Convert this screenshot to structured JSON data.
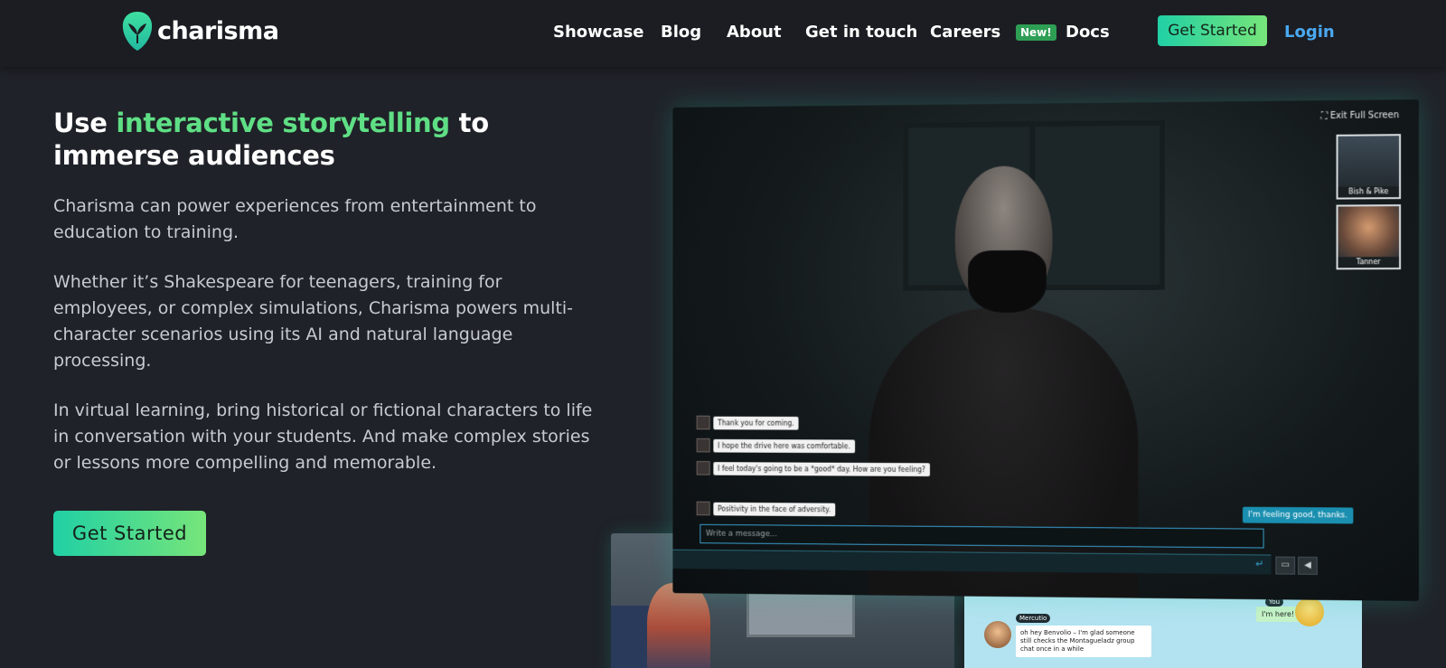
{
  "nav": {
    "brand": "charisma",
    "links": [
      "Showcase",
      "Blog",
      "About",
      "Get in touch",
      "Careers",
      "Docs"
    ],
    "careers_badge": "New!",
    "cta": "Get Started",
    "login": "Login"
  },
  "hero": {
    "headline_pre": "Use ",
    "headline_highlight": "interactive storytelling",
    "headline_post": " to immerse audiences",
    "paragraphs": [
      "Charisma can power experiences from entertainment to education to training.",
      "Whether it’s Shakespeare for teenagers, training for employees, or complex simulations, Charisma powers multi-character scenarios using its AI and natural language processing.",
      "In virtual learning, bring historical or fictional characters to life in conversation with your students. And make complex stories or lessons more compelling and memorable."
    ],
    "cta": "Get Started"
  },
  "demo": {
    "exit_fullscreen": "Exit Full Screen",
    "thumbnails": [
      "Bish & Pike",
      "Tanner"
    ],
    "messages": [
      "Thank you for coming.",
      "I hope the drive here was comfortable.",
      "I feel today's going to be a *good* day. How are you feeling?",
      "Positivity in the face of adversity."
    ],
    "reply": "I'm feeling good, thanks.",
    "input_placeholder": "Write a message...",
    "send_icon": "↵",
    "chat_icon": "speech-bubble-icon",
    "sound_icon": "speaker-icon"
  },
  "demo_chat": {
    "you_label": "You",
    "you_message": "I'm here!",
    "mercutio_label": "Mercutio",
    "mercutio_message": "oh hey Benvolio – I'm glad someone still checks the Montagueladz group chat once in a while"
  },
  "colors": {
    "accent_green": "#5fdf85",
    "cta_gradient_start": "#20d0a5",
    "cta_gradient_end": "#77e57a",
    "login_blue": "#4aa8f0",
    "background": "#1f2228"
  }
}
